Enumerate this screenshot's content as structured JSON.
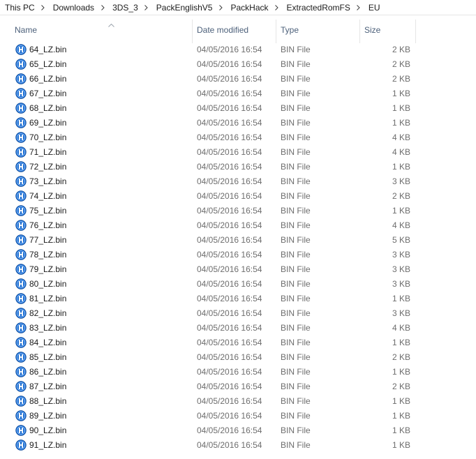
{
  "breadcrumb": [
    "This PC",
    "Downloads",
    "3DS_3",
    "PackEnglishV5",
    "PackHack",
    "ExtractedRomFS",
    "EU"
  ],
  "columns": {
    "name": "Name",
    "date": "Date modified",
    "type": "Type",
    "size": "Size",
    "sorted_by": "Name"
  },
  "icons": {
    "file": "hex-editor-file-icon",
    "separator": "chevron-right-icon",
    "sort": "sort-up-icon"
  },
  "colors": {
    "header_text": "#4c607a",
    "detail_text": "#6d6d6d",
    "icon_blue": "#1f6fd1"
  },
  "files": [
    {
      "name": "64_LZ.bin",
      "date": "04/05/2016 16:54",
      "type": "BIN File",
      "size": "2 KB"
    },
    {
      "name": "65_LZ.bin",
      "date": "04/05/2016 16:54",
      "type": "BIN File",
      "size": "2 KB"
    },
    {
      "name": "66_LZ.bin",
      "date": "04/05/2016 16:54",
      "type": "BIN File",
      "size": "2 KB"
    },
    {
      "name": "67_LZ.bin",
      "date": "04/05/2016 16:54",
      "type": "BIN File",
      "size": "1 KB"
    },
    {
      "name": "68_LZ.bin",
      "date": "04/05/2016 16:54",
      "type": "BIN File",
      "size": "1 KB"
    },
    {
      "name": "69_LZ.bin",
      "date": "04/05/2016 16:54",
      "type": "BIN File",
      "size": "1 KB"
    },
    {
      "name": "70_LZ.bin",
      "date": "04/05/2016 16:54",
      "type": "BIN File",
      "size": "4 KB"
    },
    {
      "name": "71_LZ.bin",
      "date": "04/05/2016 16:54",
      "type": "BIN File",
      "size": "4 KB"
    },
    {
      "name": "72_LZ.bin",
      "date": "04/05/2016 16:54",
      "type": "BIN File",
      "size": "1 KB"
    },
    {
      "name": "73_LZ.bin",
      "date": "04/05/2016 16:54",
      "type": "BIN File",
      "size": "3 KB"
    },
    {
      "name": "74_LZ.bin",
      "date": "04/05/2016 16:54",
      "type": "BIN File",
      "size": "2 KB"
    },
    {
      "name": "75_LZ.bin",
      "date": "04/05/2016 16:54",
      "type": "BIN File",
      "size": "1 KB"
    },
    {
      "name": "76_LZ.bin",
      "date": "04/05/2016 16:54",
      "type": "BIN File",
      "size": "4 KB"
    },
    {
      "name": "77_LZ.bin",
      "date": "04/05/2016 16:54",
      "type": "BIN File",
      "size": "5 KB"
    },
    {
      "name": "78_LZ.bin",
      "date": "04/05/2016 16:54",
      "type": "BIN File",
      "size": "3 KB"
    },
    {
      "name": "79_LZ.bin",
      "date": "04/05/2016 16:54",
      "type": "BIN File",
      "size": "3 KB"
    },
    {
      "name": "80_LZ.bin",
      "date": "04/05/2016 16:54",
      "type": "BIN File",
      "size": "3 KB"
    },
    {
      "name": "81_LZ.bin",
      "date": "04/05/2016 16:54",
      "type": "BIN File",
      "size": "1 KB"
    },
    {
      "name": "82_LZ.bin",
      "date": "04/05/2016 16:54",
      "type": "BIN File",
      "size": "3 KB"
    },
    {
      "name": "83_LZ.bin",
      "date": "04/05/2016 16:54",
      "type": "BIN File",
      "size": "4 KB"
    },
    {
      "name": "84_LZ.bin",
      "date": "04/05/2016 16:54",
      "type": "BIN File",
      "size": "1 KB"
    },
    {
      "name": "85_LZ.bin",
      "date": "04/05/2016 16:54",
      "type": "BIN File",
      "size": "2 KB"
    },
    {
      "name": "86_LZ.bin",
      "date": "04/05/2016 16:54",
      "type": "BIN File",
      "size": "1 KB"
    },
    {
      "name": "87_LZ.bin",
      "date": "04/05/2016 16:54",
      "type": "BIN File",
      "size": "2 KB"
    },
    {
      "name": "88_LZ.bin",
      "date": "04/05/2016 16:54",
      "type": "BIN File",
      "size": "1 KB"
    },
    {
      "name": "89_LZ.bin",
      "date": "04/05/2016 16:54",
      "type": "BIN File",
      "size": "1 KB"
    },
    {
      "name": "90_LZ.bin",
      "date": "04/05/2016 16:54",
      "type": "BIN File",
      "size": "1 KB"
    },
    {
      "name": "91_LZ.bin",
      "date": "04/05/2016 16:54",
      "type": "BIN File",
      "size": "1 KB"
    }
  ]
}
